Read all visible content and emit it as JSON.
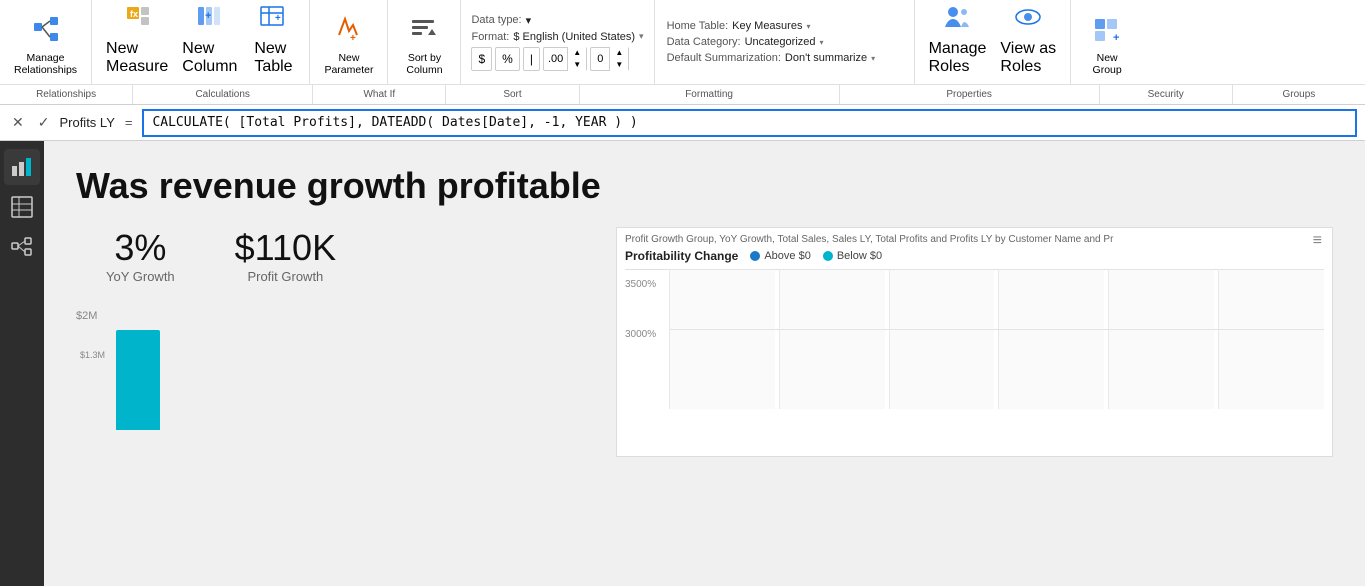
{
  "ribbon": {
    "groups": {
      "relationships": {
        "label": "Manage\nRelationships",
        "footer": "Relationships"
      },
      "calculations": {
        "buttons": [
          {
            "id": "new-measure",
            "label": "New\nMeasure"
          },
          {
            "id": "new-column",
            "label": "New\nColumn"
          },
          {
            "id": "new-table",
            "label": "New\nTable"
          }
        ],
        "footer": "Calculations"
      },
      "whatif": {
        "label": "New\nParameter",
        "footer": "What If"
      },
      "sort": {
        "label": "Sort by\nColumn",
        "footer": "Sort"
      },
      "formatting": {
        "footer": "Formatting",
        "data_type_label": "Data type:",
        "format_label": "Format:",
        "format_value": "$ English (United States)",
        "currency": "$",
        "percent": "%",
        "separator": "|",
        "decimal": ".00",
        "decimal_val": "0"
      },
      "properties": {
        "footer": "Properties",
        "home_table_label": "Home Table:",
        "home_table_value": "Key Measures",
        "data_category_label": "Data Category:",
        "data_category_value": "Uncategorized",
        "default_summarization_label": "Default Summarization:",
        "default_summarization_value": "Don't summarize"
      },
      "security": {
        "buttons": [
          {
            "id": "manage-roles",
            "label": "Manage\nRoles"
          },
          {
            "id": "view-as-roles",
            "label": "View as\nRoles"
          }
        ],
        "footer": "Security"
      },
      "groups": {
        "label": "New\nGroup",
        "footer": "Groups"
      }
    }
  },
  "formula_bar": {
    "cancel_label": "✕",
    "confirm_label": "✓",
    "field_name": "Profits LY",
    "equals": "=",
    "expression": "CALCULATE( [Total Profits], DATEADD( Dates[Date], -1, YEAR ) )"
  },
  "sidebar": {
    "items": [
      {
        "id": "bar-chart",
        "icon": "▦",
        "active": true
      },
      {
        "id": "table",
        "icon": "⊞"
      },
      {
        "id": "model",
        "icon": "⊟"
      }
    ]
  },
  "main": {
    "title": "Was revenue growth profitable",
    "metrics": [
      {
        "value": "3%",
        "label": "YoY Growth"
      },
      {
        "value": "$110K",
        "label": "Profit Growth"
      }
    ],
    "bar_chart": {
      "y_label": "$2M",
      "bars": [
        {
          "value_label": "$1.3M",
          "height": 80,
          "label": ""
        }
      ]
    },
    "scatter_chart": {
      "title": "Profit Growth Group, YoY Growth, Total Sales, Sales LY, Total Profits and Profits LY by Customer Name and Pr",
      "profitability_label": "Profitability Change",
      "legend": [
        {
          "label": "Above $0",
          "color": "#1a7ac7"
        },
        {
          "label": "Below $0",
          "color": "#00b4cc"
        }
      ],
      "y_labels": [
        "3500%",
        "3000%"
      ]
    }
  }
}
